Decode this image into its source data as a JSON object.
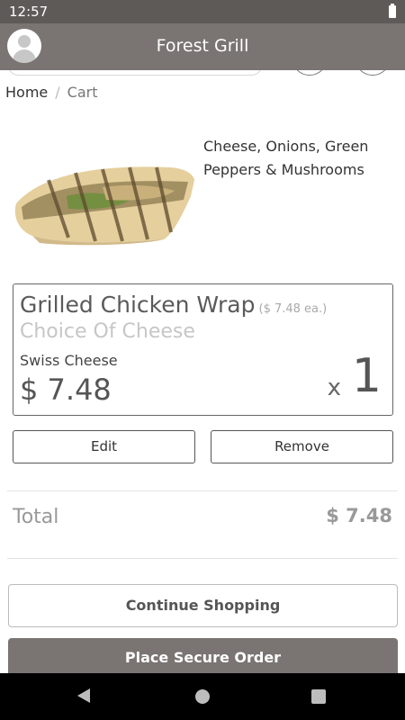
{
  "status_bar": {
    "time": "12:57",
    "battery_icon": "battery-icon"
  },
  "app_bar": {
    "title": "Forest Grill",
    "avatar_icon": "user-avatar-icon"
  },
  "breadcrumb": {
    "home": "Home",
    "separator": "/",
    "current": "Cart"
  },
  "product": {
    "image": "grilled-chicken-wrap-photo",
    "description": "Cheese, Onions, Green Peppers & Mushrooms"
  },
  "cart_item": {
    "name": "Grilled Chicken Wrap",
    "unit_price": "($ 7.48 ea.)",
    "choice_label": "Choice Of Cheese",
    "option": "Swiss Cheese",
    "price": "$ 7.48",
    "qty_prefix": "x",
    "quantity": "1"
  },
  "actions": {
    "edit": "Edit",
    "remove": "Remove"
  },
  "total": {
    "label": "Total",
    "value": "$ 7.48"
  },
  "buttons": {
    "continue": "Continue Shopping",
    "place_order": "Place Secure Order"
  },
  "nav": {
    "back_icon": "back-triangle-icon",
    "home_icon": "home-circle-icon",
    "recents_icon": "recents-square-icon"
  },
  "colors": {
    "header": "#7a7472",
    "status_bar": "#5e5a58",
    "nav_bar": "#000000"
  }
}
